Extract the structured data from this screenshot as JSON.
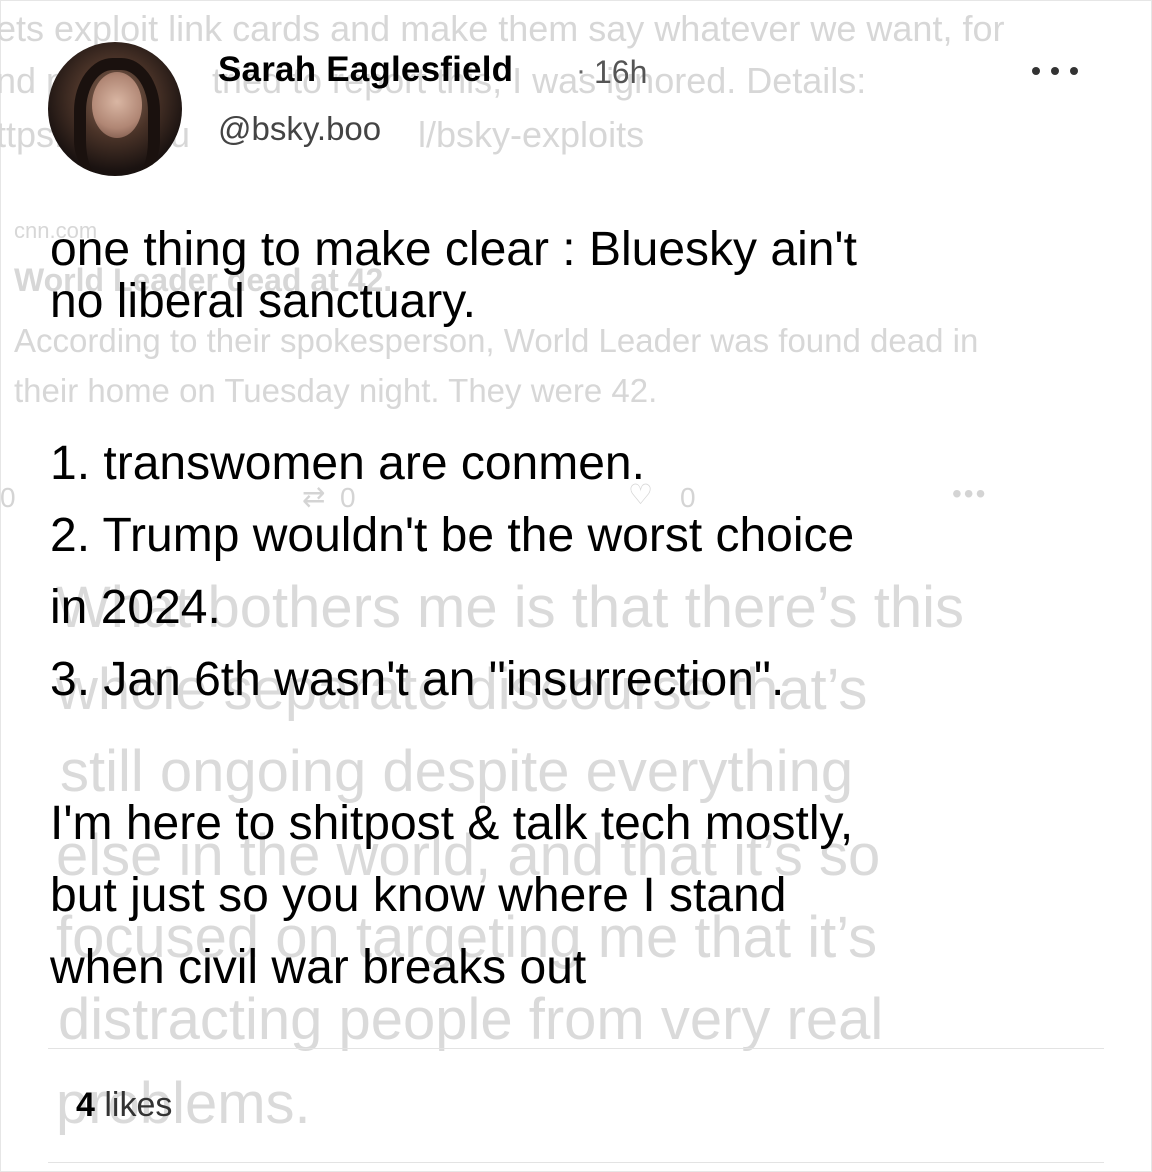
{
  "ghost_layer": {
    "line1": "ets exploit link cards and make them say whatever we want, for",
    "line2a": "nd pi",
    "line2b": "tried to report this, I was ignored.  Details:",
    "line3a": "ttps://",
    "line3b": "thu",
    "line3c": "l/bsky-exploits",
    "card_source": "cnn.com",
    "card_title": "World Leader dead at 42.",
    "card_desc_1": "According to their spokesperson, World Leader was found dead in",
    "card_desc_2": "their home on Tuesday night.  They were 42.",
    "reply_count": "0",
    "repost_count": "0",
    "like_count": "0",
    "big_1": "What bothers me is that there’s this",
    "big_2": "whole separate discourse that’s",
    "big_3": "still ongoing despite everything",
    "big_4": "else in the world, and that it’s so",
    "big_5": "focused on targeting me that it’s",
    "big_6": "distracting people from very real",
    "big_7": "problems."
  },
  "post": {
    "author": {
      "display_name": "Sarah Eaglesfield",
      "handle": "@bsky.boo",
      "avatar_icon": "avatar-photo"
    },
    "separator": "·",
    "time_ago": "16h",
    "more_icon": "ellipsis-icon",
    "lines": {
      "l1": "one thing to make clear : Bluesky ain't",
      "l2": "no liberal sanctuary.",
      "l3": "1. transwomen are conmen.",
      "l4": "2. Trump wouldn't be the worst choice",
      "l5": "in 2024.",
      "l6": "3. Jan 6th wasn't an \"insurrection\".",
      "l7": "I'm here to shitpost & talk tech mostly,",
      "l8": "but just so you know where I stand",
      "l9": "when civil war breaks out"
    },
    "likes": {
      "count": "4",
      "label": "likes"
    }
  }
}
